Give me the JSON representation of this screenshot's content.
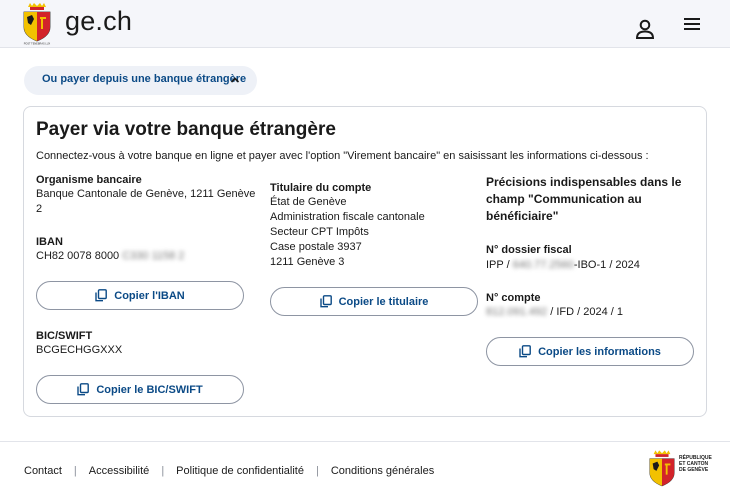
{
  "header": {
    "site_name": "ge.ch"
  },
  "accordion": {
    "label": "Ou payer depuis une banque étrangère"
  },
  "card": {
    "title": "Payer via votre banque étrangère",
    "intro": "Connectez-vous à votre banque en ligne et payer avec l'option \"Virement bancaire\" en saisissant les informations ci-dessous :",
    "bank": {
      "label": "Organisme bancaire",
      "line1": "Banque Cantonale de Genève, 1211 Genève",
      "line2": "2"
    },
    "iban": {
      "label": "IBAN",
      "visible": "CH82 0078 8000 ",
      "masked": "C330 1158 2",
      "copy_label": "Copier l'IBAN"
    },
    "bic": {
      "label": "BIC/SWIFT",
      "value": "BCGECHGGXXX",
      "copy_label": "Copier le BIC/SWIFT"
    },
    "holder": {
      "label": "Titulaire du compte",
      "lines": [
        "État de Genève",
        "Administration fiscale cantonale",
        "Secteur CPT Impôts",
        "Case postale 3937",
        "1211 Genève 3"
      ],
      "copy_label": "Copier le titulaire"
    },
    "details": {
      "heading_lines": [
        "Précisions indispensables dans le",
        "champ \"Communication au",
        "bénéficiaire\""
      ],
      "dossier_label": "N° dossier fiscal",
      "dossier_prefix": "IPP / ",
      "dossier_masked": "640.77.2560",
      "dossier_suffix": "-IBO-1 / 2024",
      "compte_label": "N° compte",
      "compte_masked": "812.091.492",
      "compte_suffix": " / IFD / 2024 / 1",
      "copy_label": "Copier les informations"
    }
  },
  "footer": {
    "links": [
      "Contact",
      "Accessibilité",
      "Politique de confidentialité",
      "Conditions générales"
    ],
    "brand_lines": [
      "RÉPUBLIQUE",
      "ET CANTON",
      "DE GENÈVE"
    ]
  },
  "colors": {
    "accent": "#0b4a86",
    "crest_red": "#d2232a",
    "crest_gold": "#f2c100"
  }
}
